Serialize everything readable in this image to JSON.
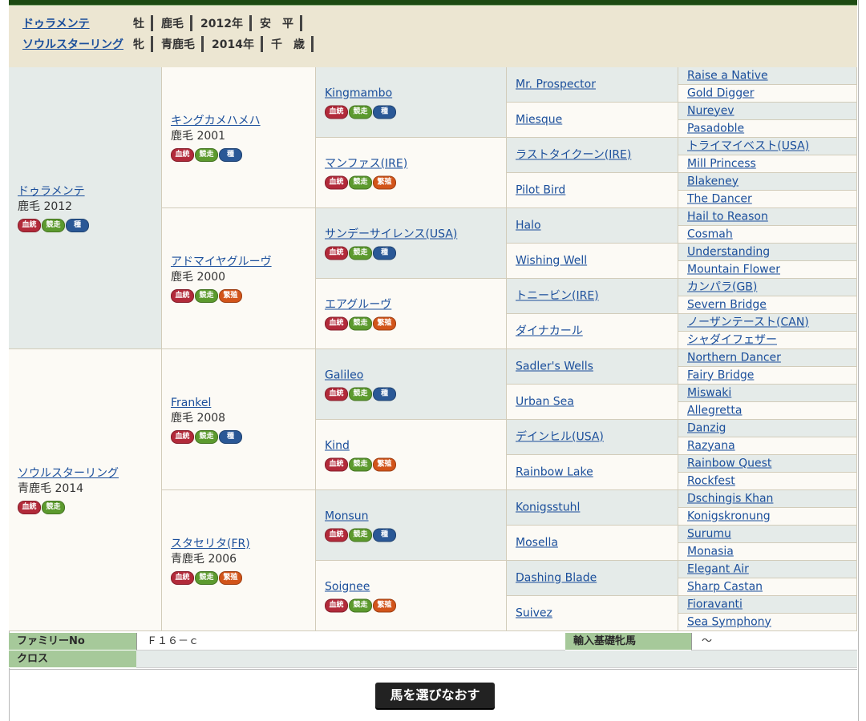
{
  "header": {
    "rows": [
      {
        "name": "ドゥラメンテ",
        "sex": "牡",
        "color": "鹿毛",
        "year": "2012年",
        "trainer": "安　平"
      },
      {
        "name": "ソウルスターリング",
        "sex": "牝",
        "color": "青鹿毛",
        "year": "2014年",
        "trainer": "千　歳"
      }
    ]
  },
  "badges": {
    "k": "血統",
    "s": "競走",
    "t": "種",
    "h": "繁殖"
  },
  "pedigree": {
    "sire": {
      "name": "ドゥラメンテ",
      "info": "鹿毛 2012"
    },
    "dam": {
      "name": "ソウルスターリング",
      "info": "青鹿毛 2014"
    },
    "g2": [
      {
        "name": "キングカメハメハ",
        "info": "鹿毛 2001"
      },
      {
        "name": "アドマイヤグルーヴ",
        "info": "鹿毛 2000"
      },
      {
        "name": "Frankel",
        "info": "鹿毛 2008"
      },
      {
        "name": "スタセリタ(FR)",
        "info": "青鹿毛 2006"
      }
    ],
    "g3": [
      "Kingmambo",
      "マンファス(IRE)",
      "サンデーサイレンス(USA)",
      "エアグルーヴ",
      "Galileo",
      "Kind",
      "Monsun",
      "Soignee"
    ],
    "g4": [
      "Mr. Prospector",
      "Miesque",
      "ラストタイクーン(IRE)",
      "Pilot Bird",
      "Halo",
      "Wishing Well",
      "トニービン(IRE)",
      "ダイナカール",
      "Sadler's Wells",
      "Urban Sea",
      "デインヒル(USA)",
      "Rainbow Lake",
      "Konigsstuhl",
      "Mosella",
      "Dashing Blade",
      "Suivez"
    ],
    "g5": [
      "Raise a Native",
      "Gold Digger",
      "Nureyev",
      "Pasadoble",
      "トライマイベスト(USA)",
      "Mill Princess",
      "Blakeney",
      "The Dancer",
      "Hail to Reason",
      "Cosmah",
      "Understanding",
      "Mountain Flower",
      "カンパラ(GB)",
      "Severn Bridge",
      "ノーザンテースト(CAN)",
      "シャダイフェザー",
      "Northern Dancer",
      "Fairy Bridge",
      "Miswaki",
      "Allegretta",
      "Danzig",
      "Razyana",
      "Rainbow Quest",
      "Rockfest",
      "Dschingis Khan",
      "Konigskronung",
      "Surumu",
      "Monasia",
      "Elegant Air",
      "Sharp Castan",
      "Fioravanti",
      "Sea Symphony"
    ]
  },
  "info": {
    "family_label": "ファミリーNo",
    "family_value": "Ｆ１６－ｃ",
    "import_label": "輸入基礎牝馬",
    "import_value": "～",
    "cross_label": "クロス",
    "cross_value": ""
  },
  "reselect_button": "馬を選びなおす"
}
